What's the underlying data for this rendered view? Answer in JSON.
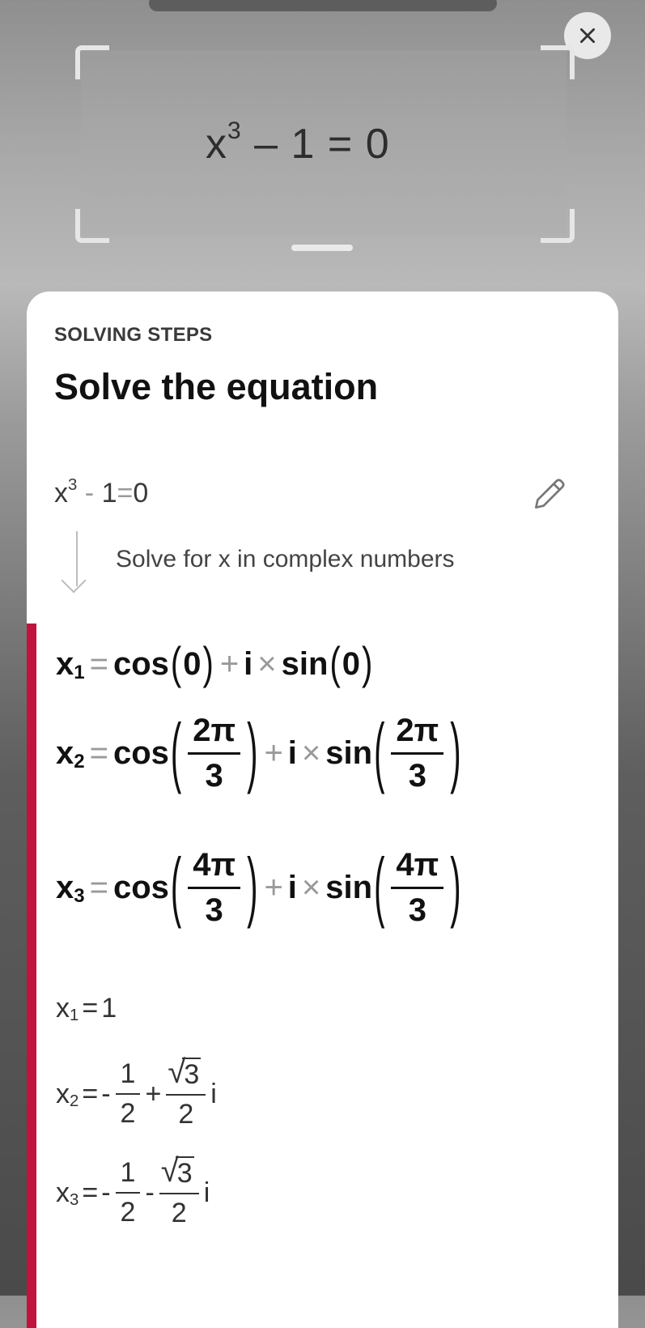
{
  "camera": {
    "scanned_equation": {
      "base": "x",
      "exponent": "3",
      "rest": "– 1 = 0"
    },
    "close_icon": "close-icon"
  },
  "sheet": {
    "section_label": "SOLVING STEPS",
    "title": "Solve the equation",
    "original_equation": {
      "base": "x",
      "exponent": "3",
      "minus": "-",
      "rest": "1",
      "eq": "=",
      "rhs": "0"
    },
    "edit_icon": "pencil-icon",
    "step_description": "Solve for x in complex numbers",
    "accent_color": "#c0143c",
    "step_equations": [
      {
        "var": "x",
        "sub": "1",
        "eq": "=",
        "func1": "cos",
        "arg1": "0",
        "plus": "+",
        "i": "i",
        "times": "×",
        "func2": "sin",
        "arg2": "0"
      },
      {
        "var": "x",
        "sub": "2",
        "eq": "=",
        "func1": "cos",
        "num1": "2π",
        "den1": "3",
        "plus": "+",
        "i": "i",
        "times": "×",
        "func2": "sin",
        "num2": "2π",
        "den2": "3"
      },
      {
        "var": "x",
        "sub": "3",
        "eq": "=",
        "func1": "cos",
        "num1": "4π",
        "den1": "3",
        "plus": "+",
        "i": "i",
        "times": "×",
        "func2": "sin",
        "num2": "4π",
        "den2": "3"
      }
    ],
    "results": [
      {
        "var": "x",
        "sub": "1",
        "eq": "=",
        "value": "1"
      },
      {
        "var": "x",
        "sub": "2",
        "eq": "=",
        "sign": "-",
        "n1": "1",
        "d1": "2",
        "op": "+",
        "rad": "3",
        "d2": "2",
        "i": "i"
      },
      {
        "var": "x",
        "sub": "3",
        "eq": "=",
        "sign": "-",
        "n1": "1",
        "d1": "2",
        "op": "-",
        "rad": "3",
        "d2": "2",
        "i": "i"
      }
    ]
  }
}
